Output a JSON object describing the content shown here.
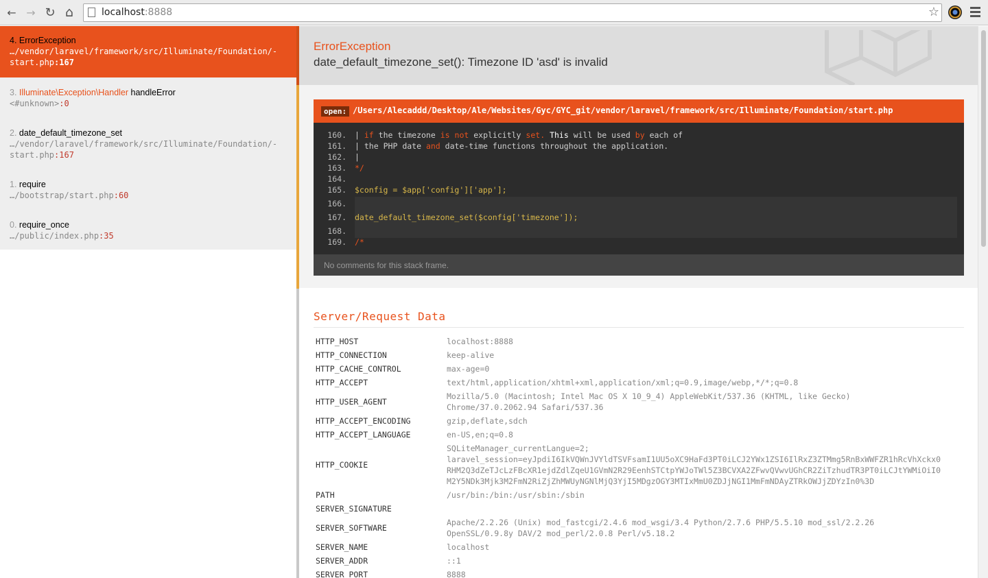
{
  "browser": {
    "back_icon": "←",
    "forward_icon": "→",
    "reload_icon": "↻",
    "home_icon": "⌂",
    "url_host": "localhost",
    "url_port": ":8888",
    "star_icon": "☆"
  },
  "frames": [
    {
      "index": "4.",
      "class": "",
      "method": "ErrorException",
      "file": "…/vendor/laravel/framework/src/Illuminate/Foundation/-",
      "file2": "start.php",
      "line": ":167",
      "active": true
    },
    {
      "index": "3.",
      "class": "Illuminate\\Exception\\Handler",
      "method": " handleError",
      "file": "<#unknown>",
      "file2": "",
      "line": ":0",
      "active": false
    },
    {
      "index": "2.",
      "class": "",
      "method": "date_default_timezone_set",
      "file": "…/vendor/laravel/framework/src/Illuminate/Foundation/-",
      "file2": "start.php",
      "line": ":167",
      "active": false
    },
    {
      "index": "1.",
      "class": "",
      "method": "require",
      "file": "…/bootstrap/start.php",
      "file2": "",
      "line": ":60",
      "active": false
    },
    {
      "index": "0.",
      "class": "",
      "method": "require_once",
      "file": "…/public/index.php",
      "file2": "",
      "line": ":35",
      "active": false
    }
  ],
  "exception": {
    "class": "ErrorException",
    "message": "date_default_timezone_set(): Timezone ID 'asd' is invalid"
  },
  "code": {
    "open_label": "open:",
    "path": "/Users/Alecaddd/Desktop/Ale/Websites/Gyc/GYC_git/vendor/laravel/framework/src/Illuminate/Foundation/start.php",
    "lines": [
      {
        "num": "160.",
        "text": "| if the timezone is not explicitly set. This will be used by each of"
      },
      {
        "num": "161.",
        "text": "| the PHP date and date-time functions throughout the application."
      },
      {
        "num": "162.",
        "text": "|"
      },
      {
        "num": "163.",
        "text": "*/"
      },
      {
        "num": "164.",
        "text": ""
      },
      {
        "num": "165.",
        "text": "$config = $app['config']['app'];"
      },
      {
        "num": "166.",
        "text": ""
      },
      {
        "num": "167.",
        "text": "date_default_timezone_set($config['timezone']);"
      },
      {
        "num": "168.",
        "text": ""
      },
      {
        "num": "169.",
        "text": "/*"
      }
    ],
    "comments": "No comments for this stack frame."
  },
  "server_data": {
    "title": "Server/Request Data",
    "rows": [
      {
        "key": "HTTP_HOST",
        "value": "localhost:8888"
      },
      {
        "key": "HTTP_CONNECTION",
        "value": "keep-alive"
      },
      {
        "key": "HTTP_CACHE_CONTROL",
        "value": "max-age=0"
      },
      {
        "key": "HTTP_ACCEPT",
        "value": "text/html,application/xhtml+xml,application/xml;q=0.9,image/webp,*/*;q=0.8"
      },
      {
        "key": "HTTP_USER_AGENT",
        "value": "Mozilla/5.0 (Macintosh; Intel Mac OS X 10_9_4) AppleWebKit/537.36 (KHTML, like Gecko)\nChrome/37.0.2062.94 Safari/537.36"
      },
      {
        "key": "HTTP_ACCEPT_ENCODING",
        "value": "gzip,deflate,sdch"
      },
      {
        "key": "HTTP_ACCEPT_LANGUAGE",
        "value": "en-US,en;q=0.8"
      },
      {
        "key": "HTTP_COOKIE",
        "value": "SQLiteManager_currentLangue=2;\nlaravel_session=eyJpdiI6IkVQWnJVYldTSVFsamI1UU5oXC9HaFd3PT0iLCJ2YWx1ZSI6IlRxZ3ZTMmg5RnBxWWFZR1hRcVhXckx0\nRHM2Q3dZeTJcLzFBcXR1ejdZdlZqeU1GVmN2R29EenhSTCtpYWJoTWl5Z3BCVXA2ZFwvQVwvUGhCR2ZiTzhudTR3PT0iLCJtYWMiOiI0\nM2Y5NDk3Mjk3M2FmN2RiZjZhMWUyNGNlMjQ3YjI5MDgzOGY3MTIxMmU0ZDJjNGI1MmFmNDAyZTRkOWJjZDYzIn0%3D"
      },
      {
        "key": "PATH",
        "value": "/usr/bin:/bin:/usr/sbin:/sbin"
      },
      {
        "key": "SERVER_SIGNATURE",
        "value": ""
      },
      {
        "key": "SERVER_SOFTWARE",
        "value": "Apache/2.2.26 (Unix) mod_fastcgi/2.4.6 mod_wsgi/3.4 Python/2.7.6 PHP/5.5.10 mod_ssl/2.2.26\nOpenSSL/0.9.8y DAV/2 mod_perl/2.0.8 Perl/v5.18.2"
      },
      {
        "key": "SERVER_NAME",
        "value": "localhost"
      },
      {
        "key": "SERVER_ADDR",
        "value": "::1"
      },
      {
        "key": "SERVER_PORT",
        "value": "8888"
      }
    ]
  },
  "colors": {
    "accent": "#e8521d",
    "code_bg": "#2c2c2c",
    "sidebar_bg": "#eeeeee"
  }
}
